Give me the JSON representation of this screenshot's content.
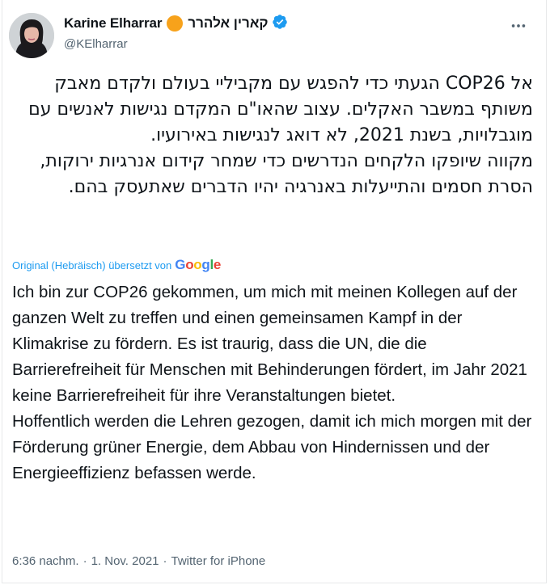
{
  "author": {
    "display_name": "Karine Elharrar",
    "display_name_hebrew": "קארין אלהרר",
    "handle": "@KElharrar"
  },
  "tweet": {
    "hebrew_paragraphs": [
      "אל COP26 הגעתי כדי להפגש עם מקביליי בעולם ולקדם מאבק משותף במשבר האקלים. עצוב שהאו\"ם המקדם נגישות לאנשים עם מוגבלויות, בשנת 2021, לא דואג לנגישות באירועיו.",
      "מקווה שיופקו הלקחים הנדרשים כדי שמחר קידום אנרגיות ירוקות, הסרת חסמים והתייעלות באנרגיה יהיו הדברים שאתעסק בהם."
    ],
    "translation_label": "Original (Hebräisch) übersetzt von",
    "translation_provider": "Google",
    "german_paragraphs": [
      "Ich bin zur COP26 gekommen, um mich mit meinen Kollegen auf der ganzen Welt zu treffen und einen gemeinsamen Kampf in der Klimakrise zu fördern. Es ist traurig, dass die UN, die die Barrierefreiheit für Menschen mit Behinderungen fördert, im Jahr 2021 keine Barrierefreiheit für ihre Veranstaltungen bietet.",
      " Hoffentlich werden die Lehren gezogen, damit ich mich morgen mit der Förderung grüner Energie, dem Abbau von Hindernissen und der Energieeffizienz befassen werde."
    ],
    "time": "6:36 nachm.",
    "date": "1. Nov. 2021",
    "separator": "·",
    "source": "Twitter for iPhone"
  },
  "colors": {
    "accent": "#1d9bf0",
    "secondary_text": "#536471",
    "emoji_orange": "#f7a21b"
  },
  "icons": [
    "more-icon",
    "verified-badge-icon",
    "orange-circle-emoji"
  ]
}
